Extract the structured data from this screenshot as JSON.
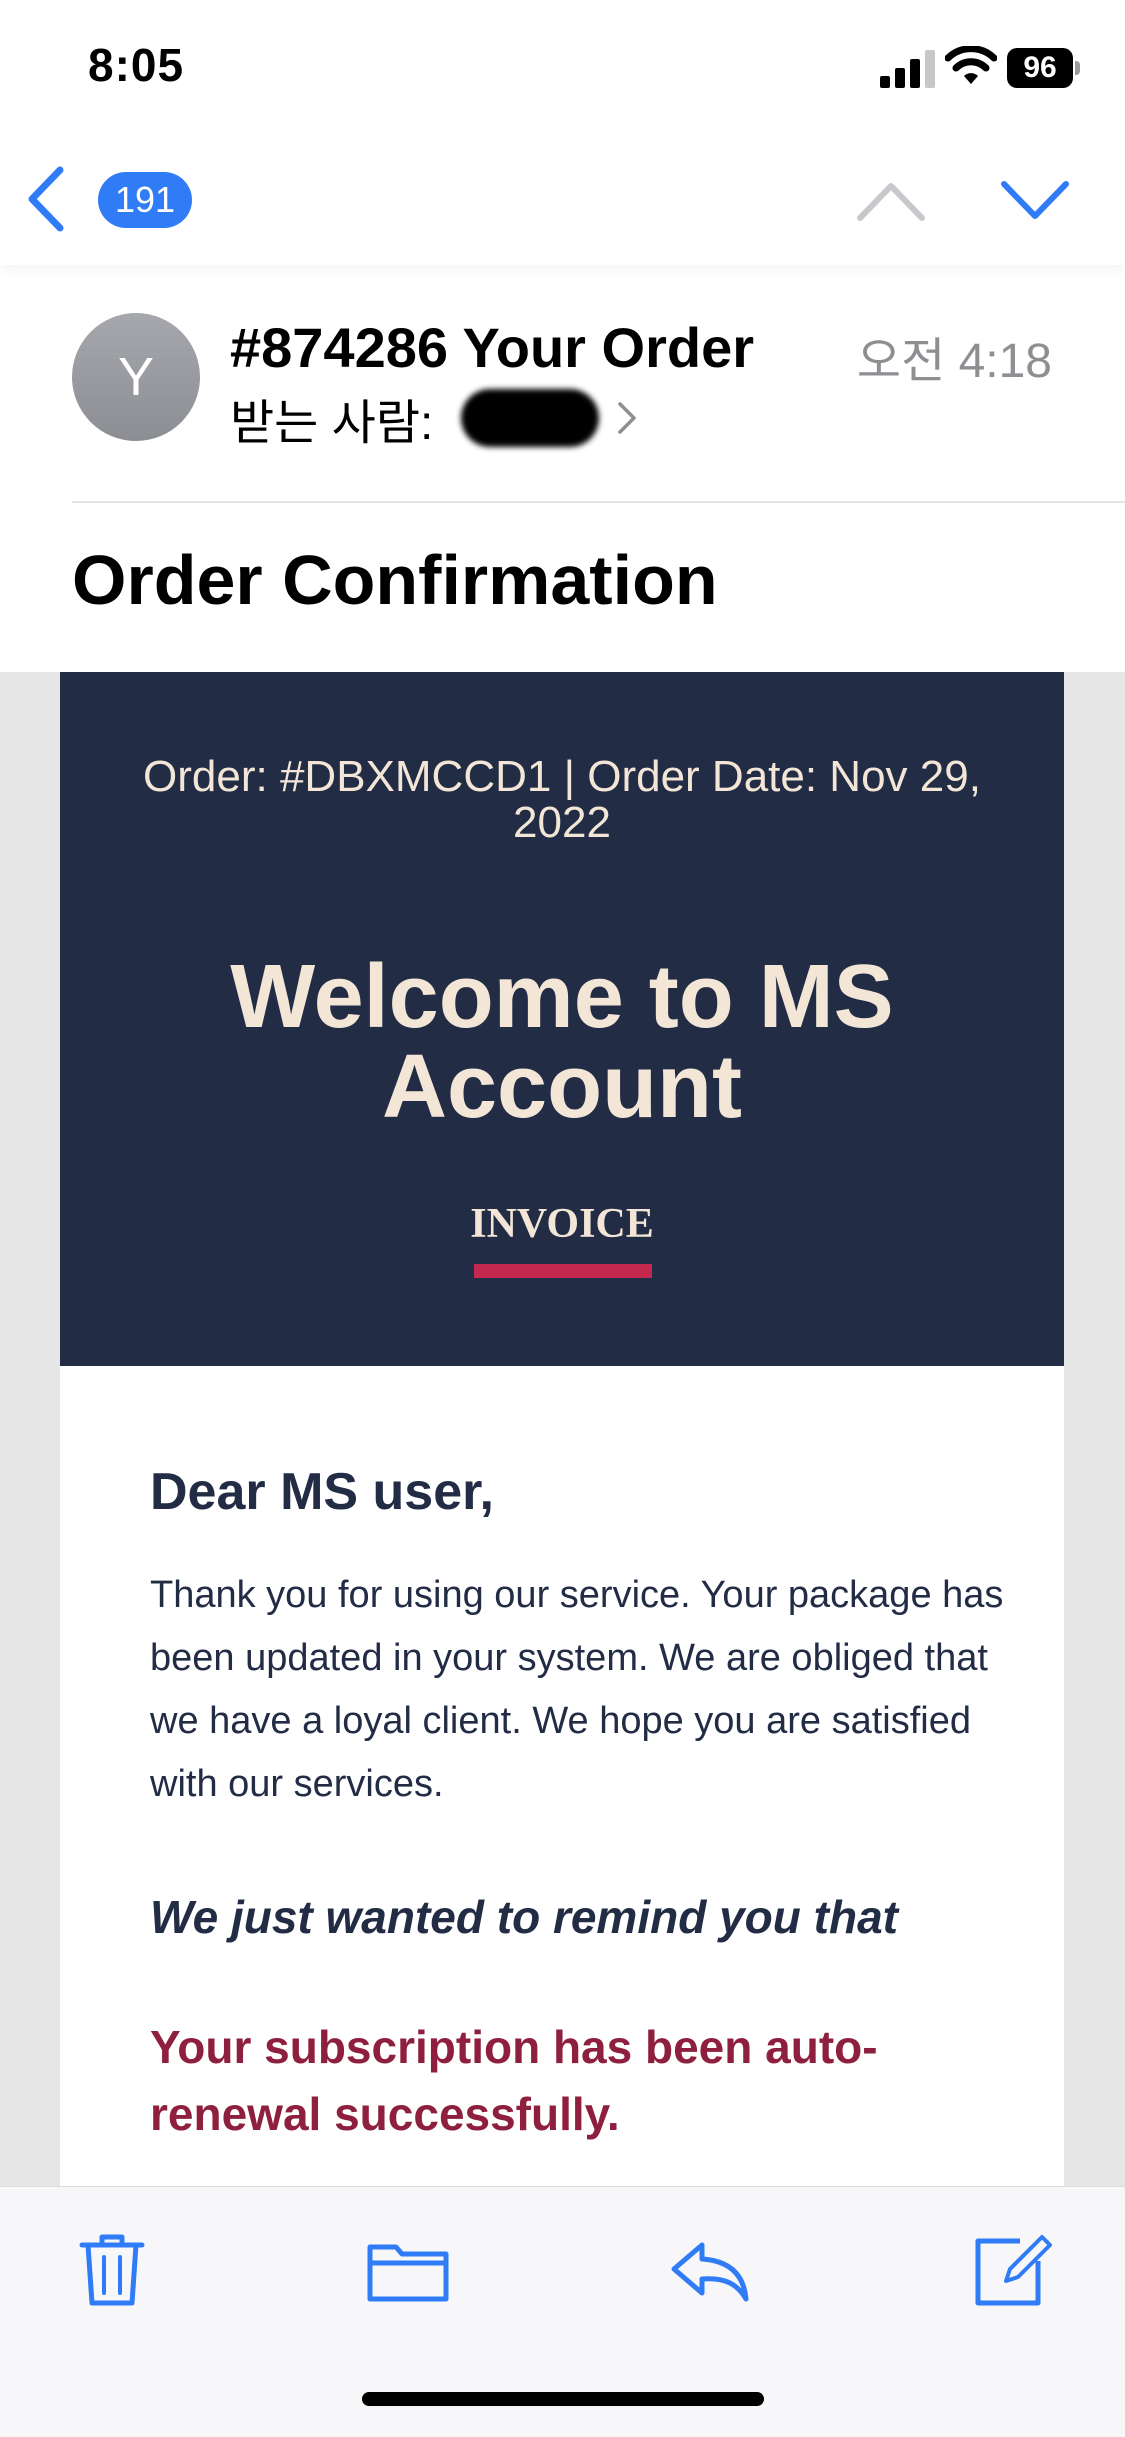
{
  "status_bar": {
    "time": "8:05",
    "battery": "96",
    "icons": [
      "signal-icon",
      "wifi-icon",
      "battery-icon"
    ]
  },
  "nav": {
    "back_icon": "chevron-left-icon",
    "message_count": "191",
    "prev_icon": "chevron-up-icon",
    "next_icon": "chevron-down-icon",
    "accent_color": "#2f7cf6"
  },
  "message": {
    "avatar_letter": "Y",
    "subject": "#874286 Your Order",
    "time": "오전 4:18",
    "recipient_label": "받는 사람:"
  },
  "content": {
    "title": "Order Confirmation"
  },
  "email": {
    "order_line": "Order: #DBXMCCD1 | Order Date: Nov 29, 2022",
    "welcome": "Welcome to MS Account",
    "invoice": "INVOICE",
    "greeting": "Dear MS user,",
    "paragraph": "Thank you for using our service. Your package has been updated in your system. We are obliged that we have a loyal client. We hope you are satisfied with our services.",
    "remind": "We just wanted to remind you that",
    "renewal": "Your subscription has been auto-renewal successfully.",
    "colors": {
      "banner": "#222c45",
      "banner_text": "#f3e6d7",
      "invoice_accent": "#c4284f",
      "renewal_text": "#8e1f3f"
    }
  },
  "toolbar": {
    "icons": [
      "trash-icon",
      "folder-icon",
      "reply-icon",
      "compose-icon"
    ]
  }
}
